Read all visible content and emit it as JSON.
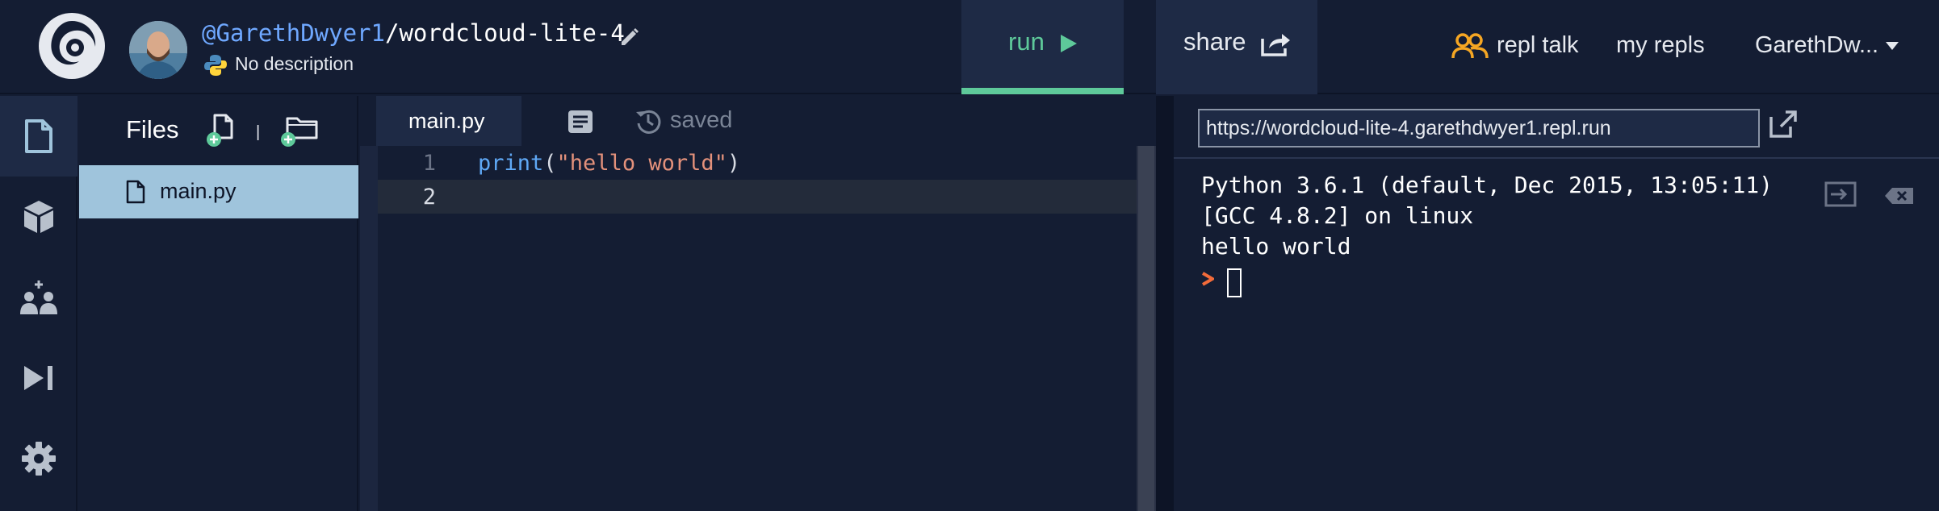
{
  "header": {
    "owner": "@GarethDwyer1",
    "separator": "/",
    "repl_name": "wordcloud-lite-4",
    "description": "No description",
    "run_label": "run",
    "share_label": "share",
    "repl_talk_label": "repl talk",
    "my_repls_label": "my repls",
    "username": "GarethDw..."
  },
  "files_panel": {
    "title": "Files",
    "separator": "|",
    "files": [
      {
        "name": "main.py",
        "selected": true
      }
    ]
  },
  "editor": {
    "active_tab": "main.py",
    "status": "saved",
    "lines": [
      {
        "number": "1",
        "fn": "print",
        "open": "(",
        "string": "\"hello world\"",
        "close": ")"
      },
      {
        "number": "2"
      }
    ]
  },
  "console": {
    "url": "https://wordcloud-lite-4.garethdwyer1.repl.run",
    "output": [
      "Python 3.6.1 (default, Dec 2015, 13:05:11)",
      "[GCC 4.8.2] on linux",
      "hello world"
    ]
  },
  "colors": {
    "background": "#141d33",
    "panel": "#1e2a45",
    "accent_green": "#5ec99a",
    "accent_orange": "#f5a623",
    "selected_file": "#9fc4dc",
    "link_blue": "#6fa8ff",
    "string": "#e3917b"
  },
  "icons": {
    "sidebar": [
      "files-icon",
      "packages-icon",
      "multiplayer-icon",
      "debugger-icon",
      "settings-icon"
    ],
    "header": [
      "replit-logo",
      "pencil-icon",
      "python-icon",
      "play-icon",
      "share-icon",
      "repl-talk-icon",
      "caret-down-icon"
    ]
  }
}
